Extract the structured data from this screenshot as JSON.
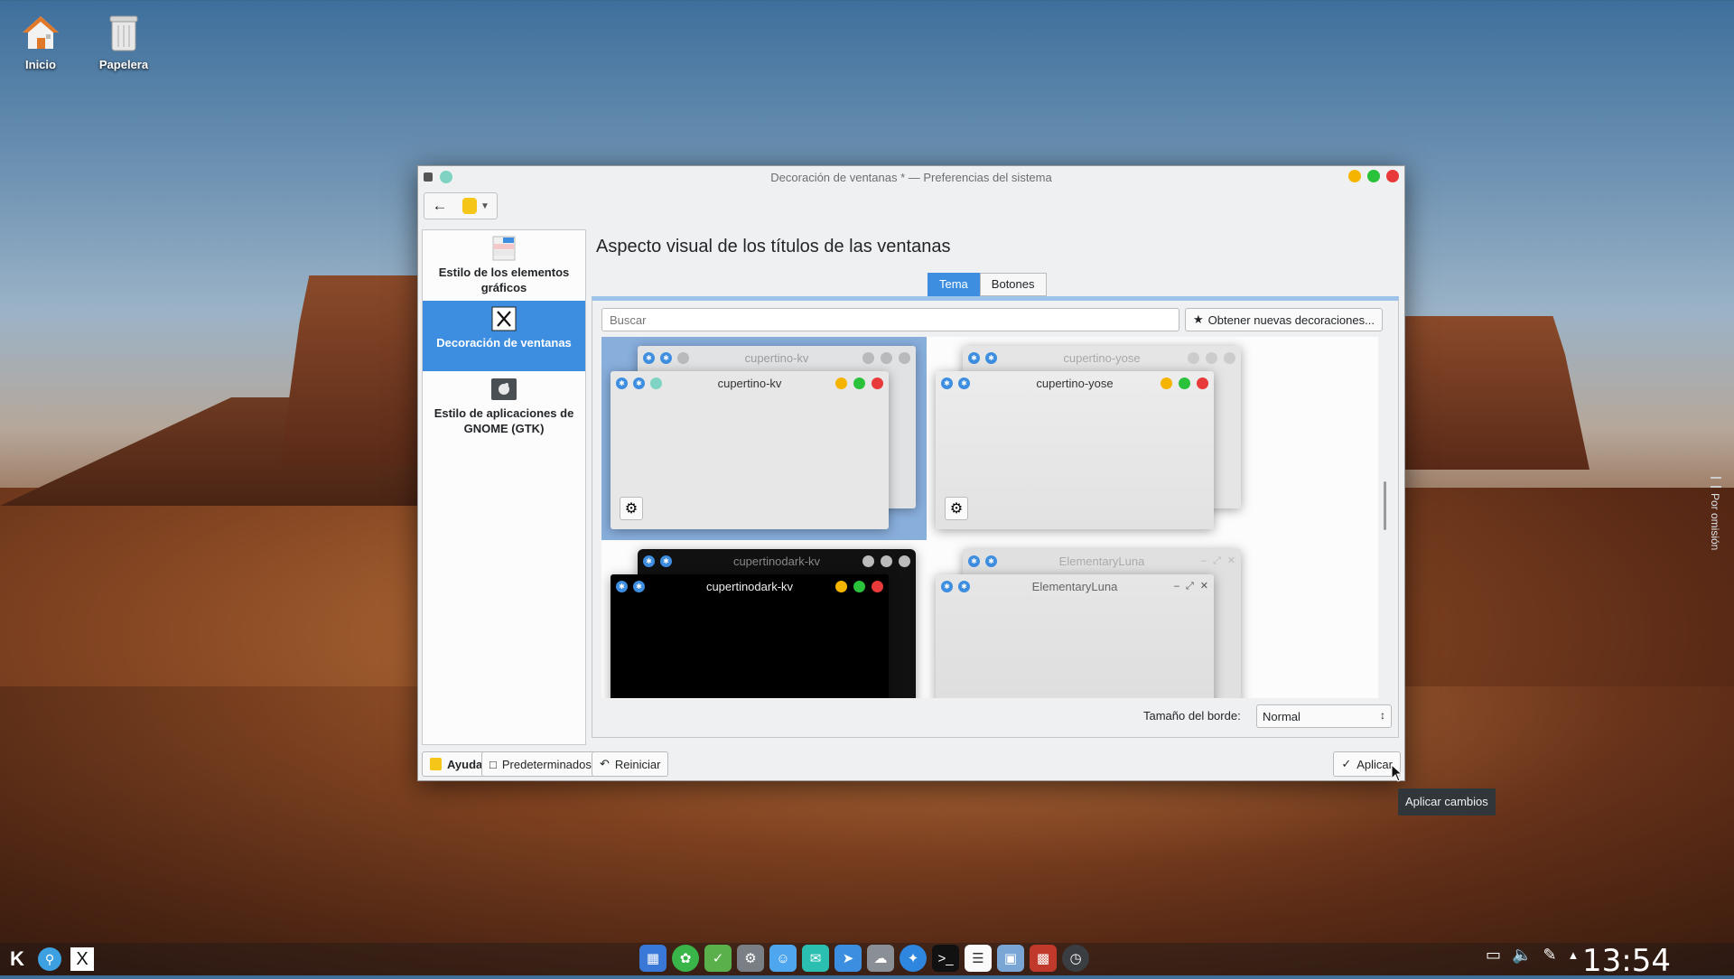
{
  "desktop": {
    "icons": [
      {
        "label": "Inicio",
        "icon": "home-icon"
      },
      {
        "label": "Papelera",
        "icon": "trash-icon"
      }
    ]
  },
  "window": {
    "title": "Decoración de ventanas * — Preferencias del sistema",
    "buttons": {
      "minimize": "#f5b400",
      "maximize": "#29c23a",
      "close": "#e83a3a"
    }
  },
  "sidebar": {
    "items": [
      {
        "label": "Estilo de los elementos gráficos",
        "icon": "widget-style-icon"
      },
      {
        "label": "Decoración de ventanas",
        "icon": "window-decoration-icon"
      },
      {
        "label": "Estilo de aplicaciones de GNOME (GTK)",
        "icon": "gtk-icon"
      }
    ]
  },
  "main": {
    "page_title": "Aspecto visual de los títulos de las ventanas",
    "tabs": [
      {
        "label": "Tema"
      },
      {
        "label": "Botones"
      }
    ],
    "search": {
      "placeholder": "Buscar"
    },
    "get_new_label": "Obtener nuevas decoraciones...",
    "themes": [
      {
        "name": "cupertino-kv"
      },
      {
        "name": "cupertino-yose"
      },
      {
        "name": "cupertinodark-kv"
      },
      {
        "name": "ElementaryLuna"
      }
    ],
    "border_size": {
      "label": "Tamaño del borde:",
      "value": "Normal"
    }
  },
  "footer": {
    "help": "Ayuda",
    "defaults": "Predeterminados",
    "reset": "Reiniciar",
    "apply": "Aplicar"
  },
  "tooltip": "Aplicar cambios",
  "side_panel_label": "Por omisión",
  "panel": {
    "clock": "13:54"
  }
}
